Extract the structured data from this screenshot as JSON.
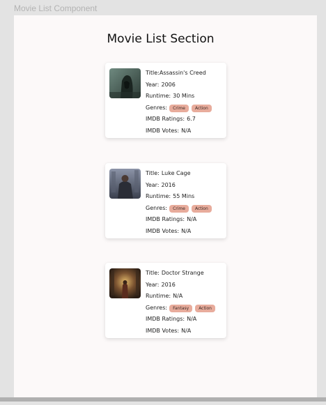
{
  "frame": {
    "title": "Movie List Component"
  },
  "section": {
    "title": "Movie List Section"
  },
  "movies": [
    {
      "title_label": "Title:",
      "title": "Assassin's Creed",
      "year_label": "Year:",
      "year": "2006",
      "runtime_label": "Runtime:",
      "runtime": "30 Mins",
      "genres_label": "Genres:",
      "genres": [
        "Crime",
        "Action"
      ],
      "rating_label": "IMDB Ratings:",
      "rating": "6.7",
      "votes_label": "IMDB Votes:",
      "votes": "N/A"
    },
    {
      "title_label": "Title:",
      "title": "Luke Cage",
      "year_label": "Year:",
      "year": "2016",
      "runtime_label": "Runtime:",
      "runtime": "55 Mins",
      "genres_label": "Genres:",
      "genres": [
        "Crime",
        "Action"
      ],
      "rating_label": "IMDB Ratings:",
      "rating": "N/A",
      "votes_label": "IMDB Votes:",
      "votes": "N/A"
    },
    {
      "title_label": "Title:",
      "title": "Doctor Strange",
      "year_label": "Year:",
      "year": "2016",
      "runtime_label": "Runtime:",
      "runtime": "N/A",
      "genres_label": "Genres:",
      "genres": [
        "Fantasy",
        "Action"
      ],
      "rating_label": "IMDB Ratings:",
      "rating": "N/A",
      "votes_label": "IMDB Votes:",
      "votes": "N/A"
    }
  ],
  "colors": {
    "tag_background": "#e8ac9c",
    "frame_background": "#fcf9f9",
    "page_background": "#e3e3e3"
  }
}
